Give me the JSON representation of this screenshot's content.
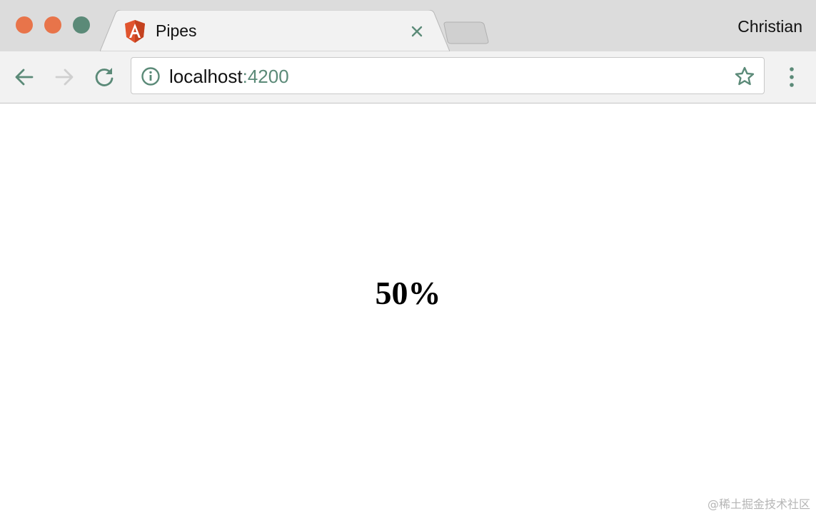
{
  "browser": {
    "tab": {
      "title": "Pipes",
      "favicon_icon": "angular-icon"
    },
    "profile_name": "Christian",
    "address_bar": {
      "host": "localhost",
      "port": ":4200"
    },
    "colors": {
      "accent": "#5b8a78",
      "traffic_close": "#e8744a",
      "traffic_min": "#e8744a",
      "traffic_max": "#5b8a78",
      "favicon": "#e0542e"
    }
  },
  "page": {
    "value_text": "50%"
  },
  "watermark": "@稀土掘金技术社区"
}
